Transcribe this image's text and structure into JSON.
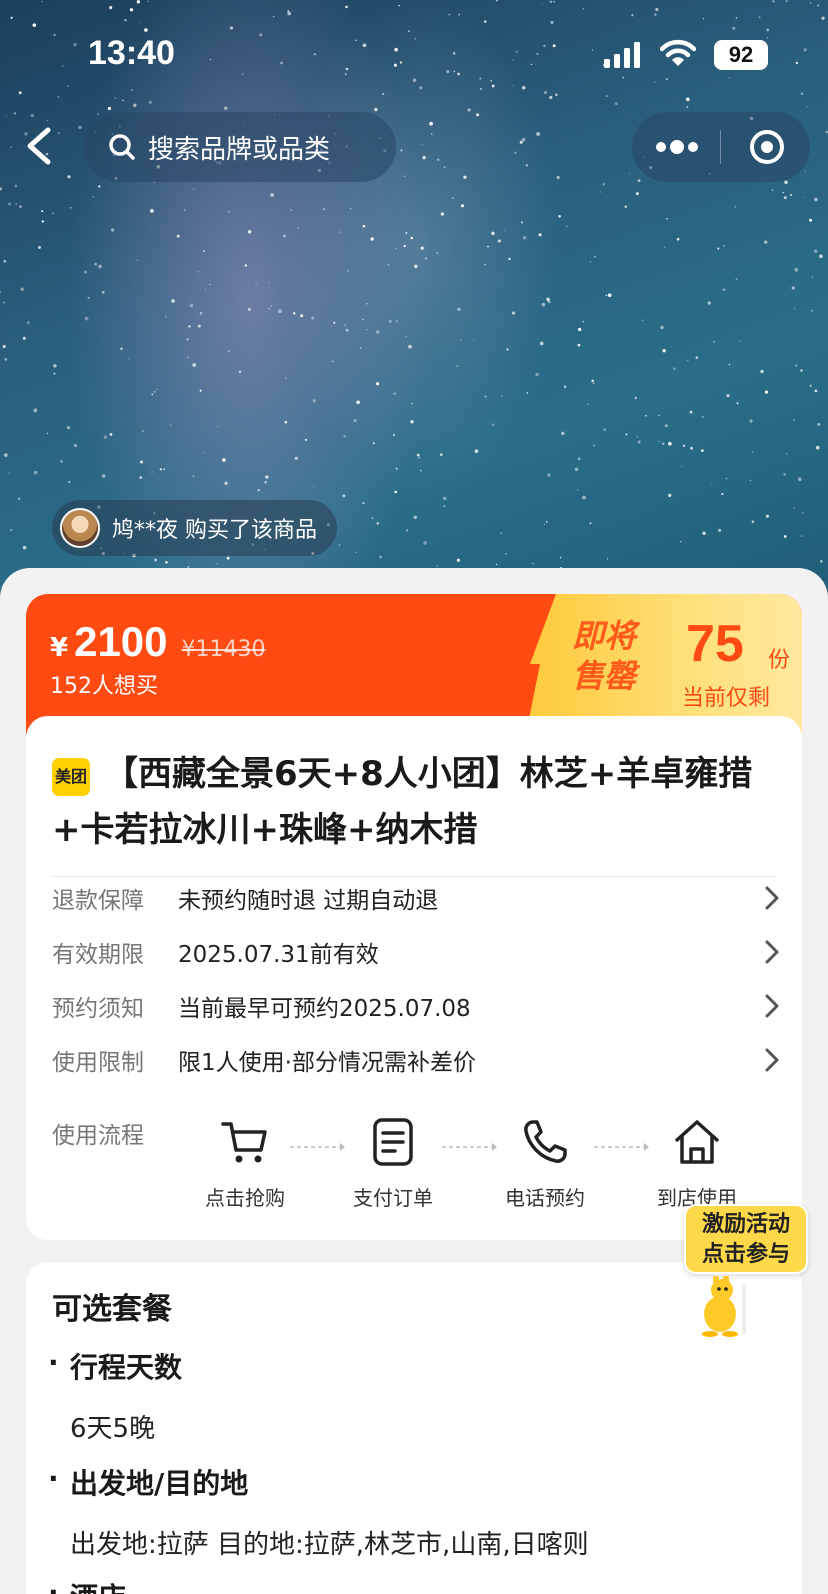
{
  "status_bar": {
    "time": "13:40",
    "battery": "92"
  },
  "nav": {
    "search_placeholder": "搜索品牌或品类"
  },
  "buyer_notice": {
    "text": "鸠**夜 购买了该商品"
  },
  "price": {
    "currency": "¥",
    "current": "2100",
    "original": "¥11430",
    "want_count": "152人想买",
    "soldout_line1": "即将",
    "soldout_line2": "售罄",
    "remaining_value": "75",
    "remaining_unit": "份",
    "remaining_label": "当前仅剩"
  },
  "product": {
    "brand_badge": "美团",
    "title": "【西藏全景6天+8人小团】林芝+羊卓雍措+卡若拉冰川+珠峰+纳木措",
    "info_rows": [
      {
        "label": "退款保障",
        "value": "未预约随时退 过期自动退"
      },
      {
        "label": "有效期限",
        "value": "2025.07.31前有效"
      },
      {
        "label": "预约须知",
        "value": "当前最早可预约2025.07.08"
      },
      {
        "label": "使用限制",
        "value": "限1人使用·部分情况需补差价"
      }
    ],
    "flow_label": "使用流程",
    "flow_steps": [
      {
        "label": "点击抢购",
        "icon": "cart-icon"
      },
      {
        "label": "支付订单",
        "icon": "document-icon"
      },
      {
        "label": "电话预约",
        "icon": "phone-icon"
      },
      {
        "label": "到店使用",
        "icon": "home-icon"
      }
    ]
  },
  "promo": {
    "line1": "激励活动",
    "line2": "点击参与"
  },
  "package": {
    "title": "可选套餐",
    "sections": [
      {
        "bullet": "·",
        "heading": "行程天数",
        "value": "6天5晚"
      },
      {
        "bullet": "·",
        "heading": "出发地/目的地",
        "value": "出发地:拉萨 目的地:拉萨,林芝市,山南,日喀则"
      },
      {
        "bullet": "·",
        "heading": "酒店",
        "value": ""
      }
    ]
  },
  "colors": {
    "accent": "#ff4a12",
    "brand_yellow": "#ffd100"
  }
}
